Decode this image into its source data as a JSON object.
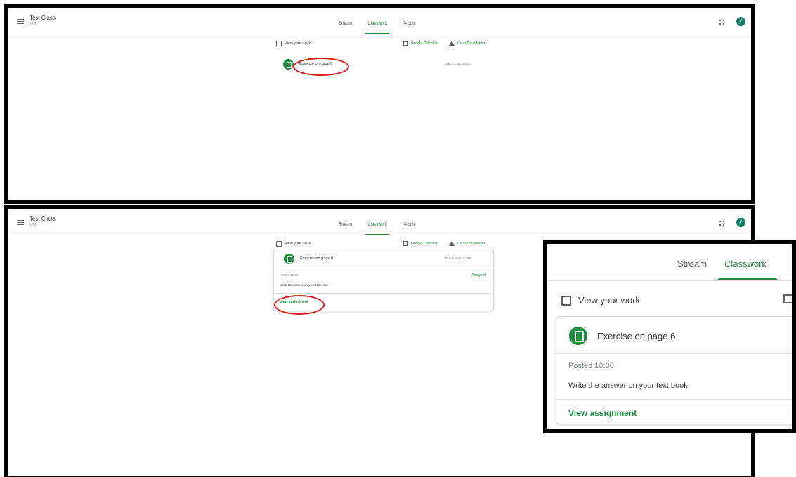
{
  "header": {
    "class_title": "Test Class",
    "class_subtitle": "Test",
    "tabs": [
      {
        "label": "Stream"
      },
      {
        "label": "Classwork"
      },
      {
        "label": "People"
      }
    ],
    "avatar_initial": "Y"
  },
  "classwork": {
    "view_your_work": "View your work",
    "google_calendar": "Google Calendar",
    "class_drive_folder": "Class Drive folder",
    "assignment": {
      "title": "Exercise on page 6",
      "due": "Due 5 Sept, 23:59",
      "posted": "Posted 10:00",
      "status": "Assigned",
      "instructions": "Write the answer on your text book",
      "view_label": "View assignment"
    }
  },
  "icons": {
    "menu": "menu-icon",
    "apps": "apps-grid-icon",
    "view_work": "assignment-ind-icon",
    "calendar": "calendar-icon",
    "drive": "drive-icon",
    "assignment": "assignment-icon"
  },
  "colors": {
    "accent": "#1e8e3e",
    "avatar": "#1a7f6e",
    "highlight": "#e21a1a"
  }
}
